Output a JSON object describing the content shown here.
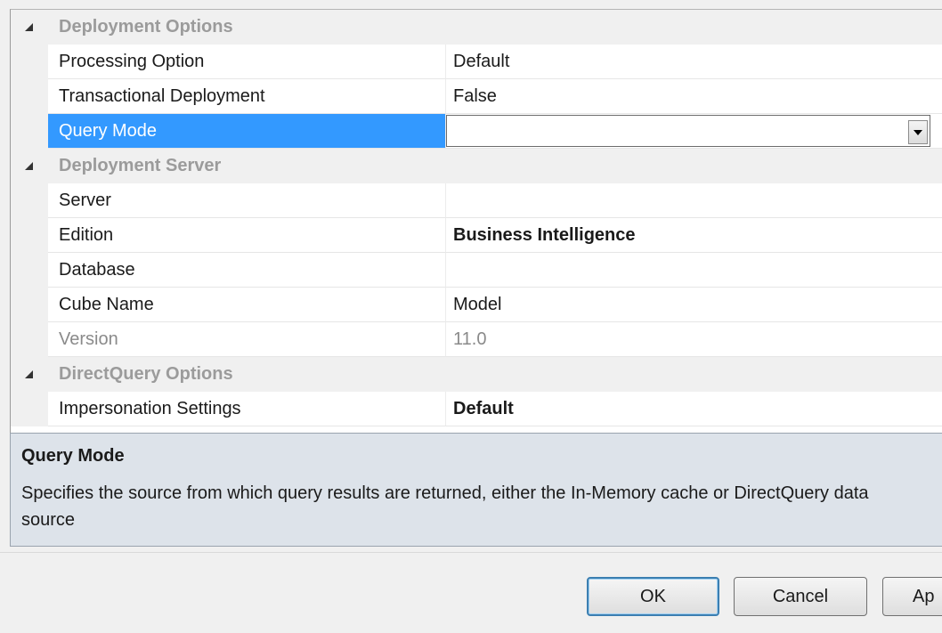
{
  "categories": {
    "deployment_options": {
      "label": "Deployment Options",
      "rows": [
        {
          "name": "Processing Option",
          "value": "Default"
        },
        {
          "name": "Transactional Deployment",
          "value": "False"
        },
        {
          "name": "Query Mode",
          "value": ""
        }
      ]
    },
    "deployment_server": {
      "label": "Deployment Server",
      "rows": [
        {
          "name": "Server",
          "value": ""
        },
        {
          "name": "Edition",
          "value": "Business Intelligence"
        },
        {
          "name": "Database",
          "value": ""
        },
        {
          "name": "Cube Name",
          "value": "Model"
        },
        {
          "name": "Version",
          "value": "11.0"
        }
      ]
    },
    "directquery_options": {
      "label": "DirectQuery Options",
      "rows": [
        {
          "name": "Impersonation Settings",
          "value": "Default"
        }
      ]
    }
  },
  "description": {
    "title": "Query Mode",
    "text": "Specifies the source from which query results are returned, either the In-Memory cache or DirectQuery data source"
  },
  "buttons": {
    "ok": "OK",
    "cancel": "Cancel",
    "apply": "Ap"
  },
  "colors": {
    "selection": "#3399ff",
    "description_bg": "#dde3ea",
    "category_text": "#9b9b9b"
  }
}
